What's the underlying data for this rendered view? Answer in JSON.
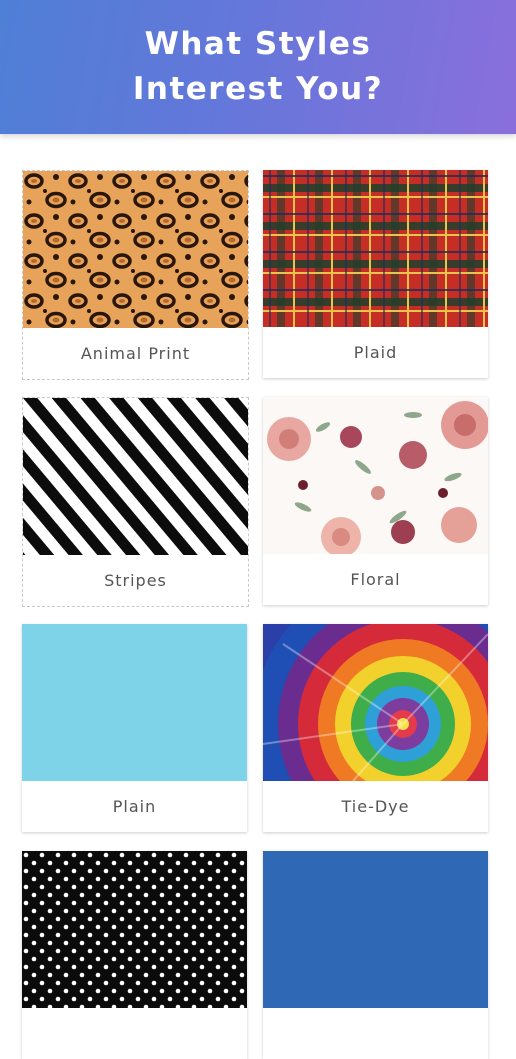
{
  "header": {
    "title_line_1": "What Styles",
    "title_line_2": "Interest You?"
  },
  "styles": [
    {
      "label": "Animal Print",
      "pattern": "leopard"
    },
    {
      "label": "Plaid",
      "pattern": "tartan"
    },
    {
      "label": "Stripes",
      "pattern": "diagonal-stripes"
    },
    {
      "label": "Floral",
      "pattern": "roses"
    },
    {
      "label": "Plain",
      "pattern": "solid",
      "color": "#7fd3e8"
    },
    {
      "label": "Tie-Dye",
      "pattern": "spiral"
    },
    {
      "label": "",
      "pattern": "polka-dots"
    },
    {
      "label": "",
      "pattern": "solid",
      "color": "#2f69b6"
    }
  ],
  "colors": {
    "header_gradient_start": "#4f7fd6",
    "header_gradient_end": "#8a6fdc",
    "leopard_base": "#e8a35b",
    "plaid_base": "#c62d25",
    "plain": "#7fd3e8",
    "blue": "#2f69b6"
  }
}
